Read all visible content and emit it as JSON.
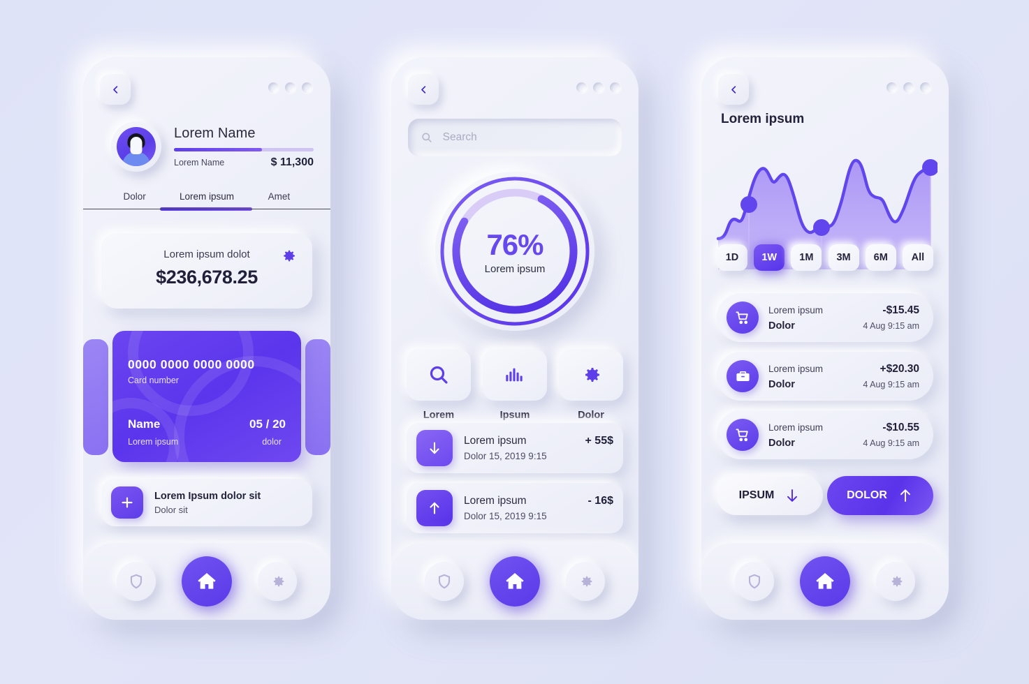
{
  "common": {
    "back_icon": "chevron-left-icon",
    "status_dots": [
      "dot",
      "dot",
      "dot"
    ],
    "nav": {
      "shield_label": "shield-icon",
      "home_label": "home-icon",
      "gear_label": "gear-icon"
    }
  },
  "colors": {
    "background": "#dfe3f7",
    "surface": "#eceef8",
    "accent": "#5e3ee8",
    "accent_light": "#8a71f2",
    "text_dark": "#21213a",
    "text_muted": "#4a4a60"
  },
  "screen1": {
    "profile": {
      "name": "Lorem Name",
      "sub_label": "Lorem Name",
      "amount": "$ 11,300",
      "progress_percent": 63
    },
    "tabs": [
      {
        "label": "Dolor",
        "active": false
      },
      {
        "label": "Lorem ipsum",
        "active": true
      },
      {
        "label": "Amet",
        "active": false
      }
    ],
    "balance": {
      "title": "Lorem ipsum dolot",
      "amount": "$236,678.25",
      "gear_icon": "gear-icon"
    },
    "card": {
      "number": "0000 0000 0000 0000",
      "number_label": "Card number",
      "name": "Name",
      "name_label": "Lorem ipsum",
      "expiry": "05 / 20",
      "expiry_label": "dolor"
    },
    "add_row": {
      "icon": "plus-icon",
      "title": "Lorem Ipsum dolor sit",
      "subtitle": "Dolor sit"
    }
  },
  "screen2": {
    "search": {
      "placeholder": "Search",
      "value": "",
      "icon": "search-icon"
    },
    "donut": {
      "percent_label": "76%",
      "caption": "Lorem ipsum",
      "value": 76
    },
    "quick_actions": [
      {
        "label": "Lorem",
        "icon": "search-icon"
      },
      {
        "label": "Ipsum",
        "icon": "bar-chart-icon"
      },
      {
        "label": "Dolor",
        "icon": "gear-icon"
      }
    ],
    "transactions": [
      {
        "icon": "arrow-down-icon",
        "title": "Lorem ipsum",
        "amount": "+ 55$",
        "date": "Dolor 15, 2019 9:15"
      },
      {
        "icon": "arrow-up-icon",
        "title": "Lorem ipsum",
        "amount": "- 16$",
        "date": "Dolor 15, 2019 9:15"
      }
    ]
  },
  "screen3": {
    "title": "Lorem ipsum",
    "ranges": [
      {
        "label": "1D",
        "active": false
      },
      {
        "label": "1W",
        "active": true
      },
      {
        "label": "1M",
        "active": false
      },
      {
        "label": "3M",
        "active": false
      },
      {
        "label": "6M",
        "active": false
      },
      {
        "label": "All",
        "active": false
      }
    ],
    "transactions": [
      {
        "icon": "shopping-cart-icon",
        "title": "Lorem ipsum",
        "amount": "-$15.45",
        "category": "Dolor",
        "time": "4 Aug  9:15 am"
      },
      {
        "icon": "briefcase-icon",
        "title": "Lorem ipsum",
        "amount": "+$20.30",
        "category": "Dolor",
        "time": "4 Aug  9:15 am"
      },
      {
        "icon": "shopping-cart-icon",
        "title": "Lorem ipsum",
        "amount": "-$10.55",
        "category": "Dolor",
        "time": "4 Aug  9:15 am"
      }
    ],
    "cta": [
      {
        "label": "IPSUM",
        "icon": "arrow-down-icon",
        "style": "ghost"
      },
      {
        "label": "DOLOR",
        "icon": "arrow-up-icon",
        "style": "solid"
      }
    ]
  },
  "chart_data": {
    "type": "area",
    "title": "Lorem ipsum",
    "xlabel": "",
    "ylabel": "",
    "grid": false,
    "legend": "none",
    "x": [
      0,
      4,
      8,
      12,
      16,
      20,
      24,
      28,
      32,
      36,
      40,
      44,
      48,
      52,
      56,
      60,
      64,
      68,
      72,
      76,
      80,
      84,
      88,
      92,
      96,
      100
    ],
    "values": [
      18,
      20,
      25,
      24,
      38,
      46,
      72,
      80,
      66,
      70,
      63,
      44,
      30,
      27,
      33,
      44,
      46,
      55,
      82,
      96,
      93,
      70,
      66,
      52,
      38,
      47,
      74,
      80
    ],
    "markers": [
      {
        "x": 12,
        "y": 46
      },
      {
        "x": 48,
        "y": 44
      },
      {
        "x": 96,
        "y": 80
      }
    ],
    "ylim": [
      0,
      100
    ],
    "xlim": [
      0,
      100
    ],
    "line_color": "#6146ee",
    "fill_color": "#b9a8f7"
  }
}
